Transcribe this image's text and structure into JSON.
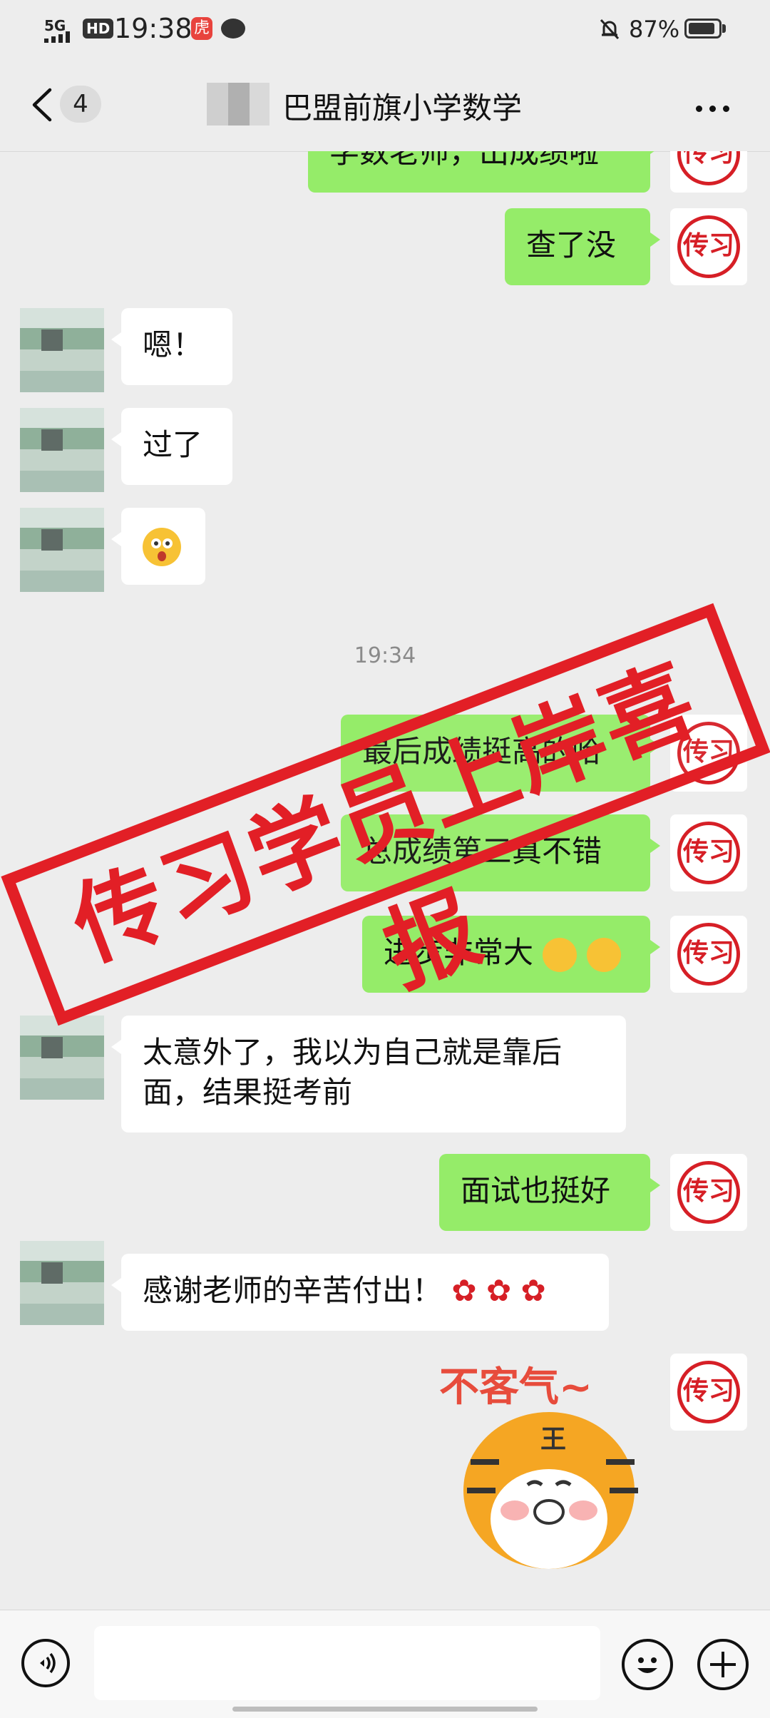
{
  "status_bar": {
    "network": "5G",
    "hd": "HD",
    "time": "19:38",
    "app_badge": "虎",
    "battery": "87%"
  },
  "nav": {
    "unread_count": "4",
    "title": "巴盟前旗小学数学"
  },
  "messages": {
    "m0": "学数老师，出成绩啦",
    "m1": "查了没",
    "m2": "嗯！",
    "m3": "过了",
    "timestamp": "19:34",
    "m5": "最后成绩挺高的哈",
    "m6": "总成绩第三真不错",
    "m7": "进步非常大",
    "m8_line1": "太意外了，我以为自己就是靠后",
    "m8_line2": "面，结果挺考前",
    "m9": "面试也挺好",
    "m10": "感谢老师的辛苦付出！",
    "m11": "不客气~"
  },
  "avatar_seal_text": "传习",
  "stamp_text": "传习学员上岸喜报",
  "sticker": {
    "label": "不客气~",
    "badge": "王"
  },
  "colors": {
    "out_bubble": "#95ec69",
    "in_bubble": "#ffffff",
    "stamp": "#e21f26",
    "background": "#ededed"
  }
}
